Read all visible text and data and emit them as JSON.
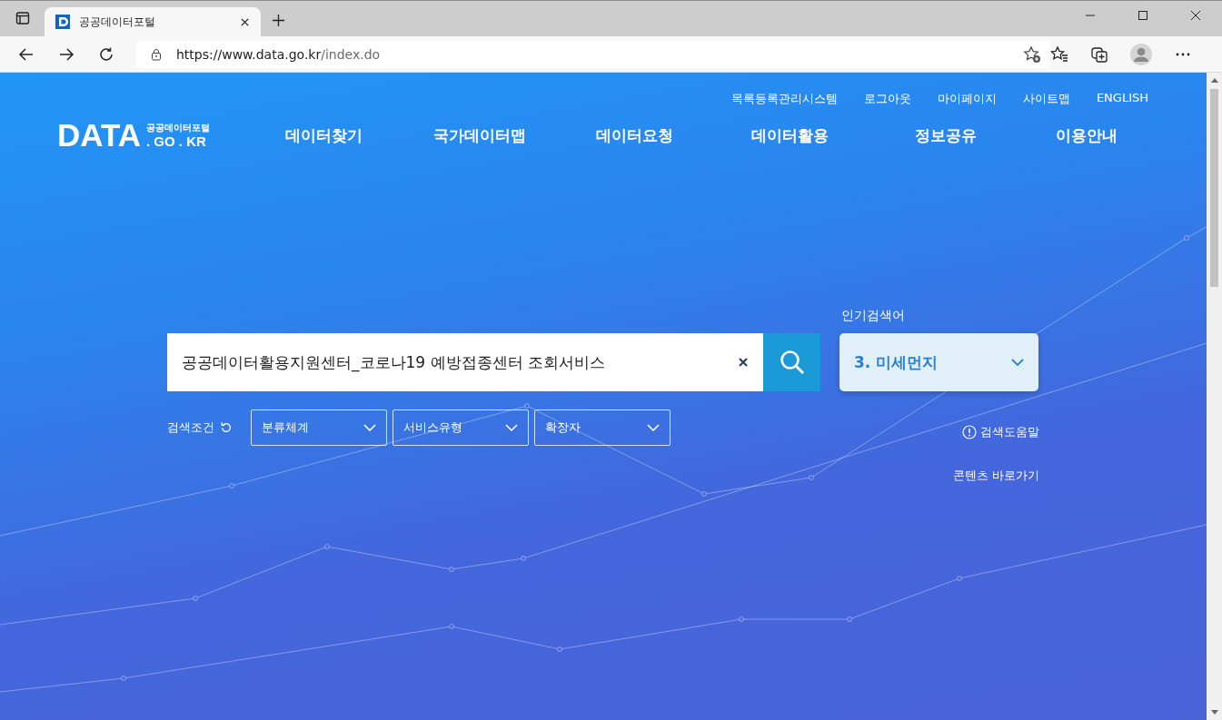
{
  "browser": {
    "tab_title": "공공데이터포털",
    "url_host": "https://www.data.go.kr",
    "url_path": "/index.do"
  },
  "util_links": [
    "목록등록관리시스템",
    "로그아웃",
    "마이페이지",
    "사이트맵",
    "ENGLISH"
  ],
  "logo": {
    "mark": "DATA",
    "subtitle": "공공데이터포털",
    "domain": ". GO . KR"
  },
  "nav": [
    "데이터찾기",
    "국가데이터맵",
    "데이터요청",
    "데이터활용",
    "정보공유",
    "이용안내"
  ],
  "search": {
    "value": "공공데이터활용지원센터_코로나19 예방접종센터 조회서비스"
  },
  "popular": {
    "label": "인기검색어",
    "value": "3. 미세먼지"
  },
  "filters": {
    "label": "검색조건",
    "selects": [
      "분류체계",
      "서비스유형",
      "확장자"
    ]
  },
  "help_link": "검색도움말",
  "shortcut_link": "콘텐츠 바로가기"
}
